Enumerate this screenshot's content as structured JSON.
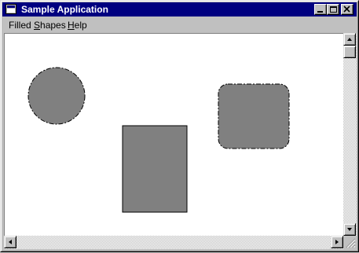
{
  "window": {
    "title": "Sample Application"
  },
  "menu": {
    "items": [
      {
        "label": "Filled Shapes",
        "accel": "S"
      },
      {
        "label": "Help",
        "accel": "H"
      }
    ]
  },
  "canvas": {
    "shapes": [
      {
        "kind": "circle",
        "fill": "#808080",
        "outline": "dash-dot"
      },
      {
        "kind": "rectangle",
        "fill": "#808080",
        "outline": "solid"
      },
      {
        "kind": "rounded-rectangle",
        "fill": "#808080",
        "outline": "dash-dot"
      }
    ]
  },
  "icons": {
    "app": "window-icon",
    "minimize": "minimize-icon",
    "maximize": "maximize-icon",
    "close": "close-icon",
    "scroll_up": "arrow-up-icon",
    "scroll_down": "arrow-down-icon",
    "scroll_left": "arrow-left-icon",
    "scroll_right": "arrow-right-icon",
    "size_grip": "size-grip-icon"
  },
  "colors": {
    "titlebar": "#000080",
    "face": "#c0c0c0",
    "client": "#ffffff",
    "shape_fill": "#808080"
  }
}
